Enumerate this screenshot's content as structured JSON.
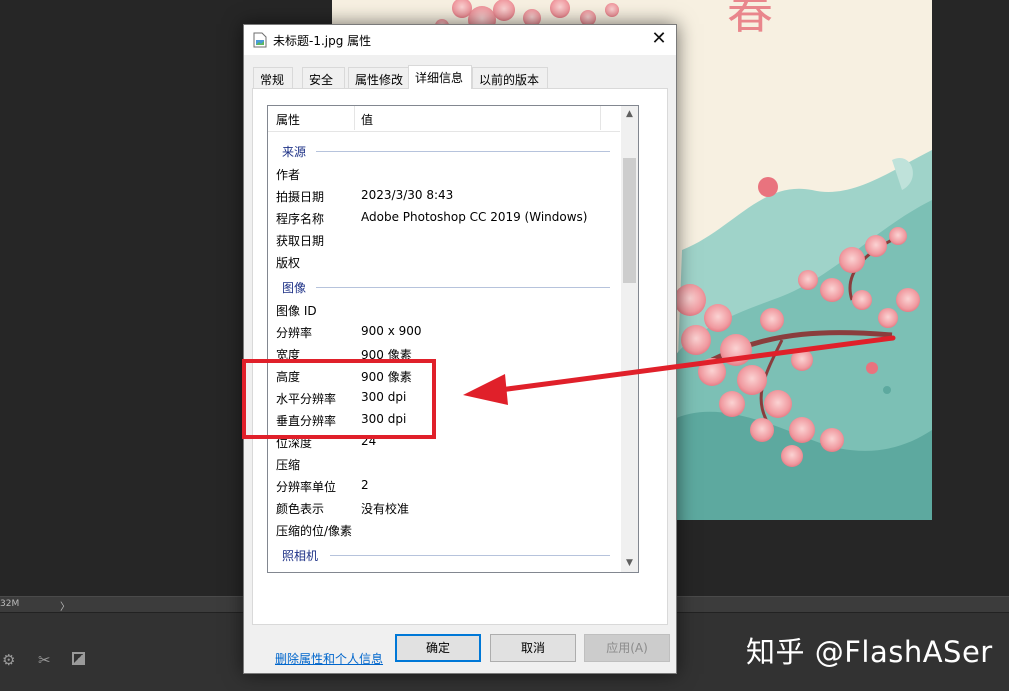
{
  "dialog": {
    "title": "未标题-1.jpg 属性",
    "close_glyph": "✕",
    "tabs": [
      {
        "label": "常规"
      },
      {
        "label": "安全"
      },
      {
        "label": "属性修改"
      },
      {
        "label": "详细信息"
      },
      {
        "label": "以前的版本"
      }
    ],
    "active_tab": "详细信息",
    "list": {
      "header_property": "属性",
      "header_value": "值",
      "groups": {
        "source": "来源",
        "image": "图像",
        "camera": "照相机"
      },
      "source_rows": [
        {
          "key": "作者",
          "value": ""
        },
        {
          "key": "拍摄日期",
          "value": "2023/3/30 8:43"
        },
        {
          "key": "程序名称",
          "value": "Adobe Photoshop CC 2019 (Windows)"
        },
        {
          "key": "获取日期",
          "value": ""
        },
        {
          "key": "版权",
          "value": ""
        }
      ],
      "image_rows": [
        {
          "key": "图像 ID",
          "value": ""
        },
        {
          "key": "分辨率",
          "value": "900 x 900"
        },
        {
          "key": "宽度",
          "value": "900 像素"
        },
        {
          "key": "高度",
          "value": "900 像素"
        },
        {
          "key": "水平分辨率",
          "value": "300 dpi"
        },
        {
          "key": "垂直分辨率",
          "value": "300 dpi"
        },
        {
          "key": "位深度",
          "value": "24"
        },
        {
          "key": "压缩",
          "value": ""
        },
        {
          "key": "分辨率单位",
          "value": "2"
        },
        {
          "key": "颜色表示",
          "value": "没有校准"
        },
        {
          "key": "压缩的位/像素",
          "value": ""
        }
      ]
    },
    "remove_link": "删除属性和个人信息",
    "buttons": {
      "ok": "确定",
      "cancel": "取消",
      "apply": "应用(A)"
    }
  },
  "background": {
    "status_zoom": "32M",
    "status_arrow": "〉",
    "art_glyph": "春"
  },
  "watermark": "知乎 @FlashASer",
  "colors": {
    "annotation": "#e0202a",
    "group_header": "#1e3287",
    "link": "#0066cc",
    "default_button_border": "#0078d7"
  }
}
